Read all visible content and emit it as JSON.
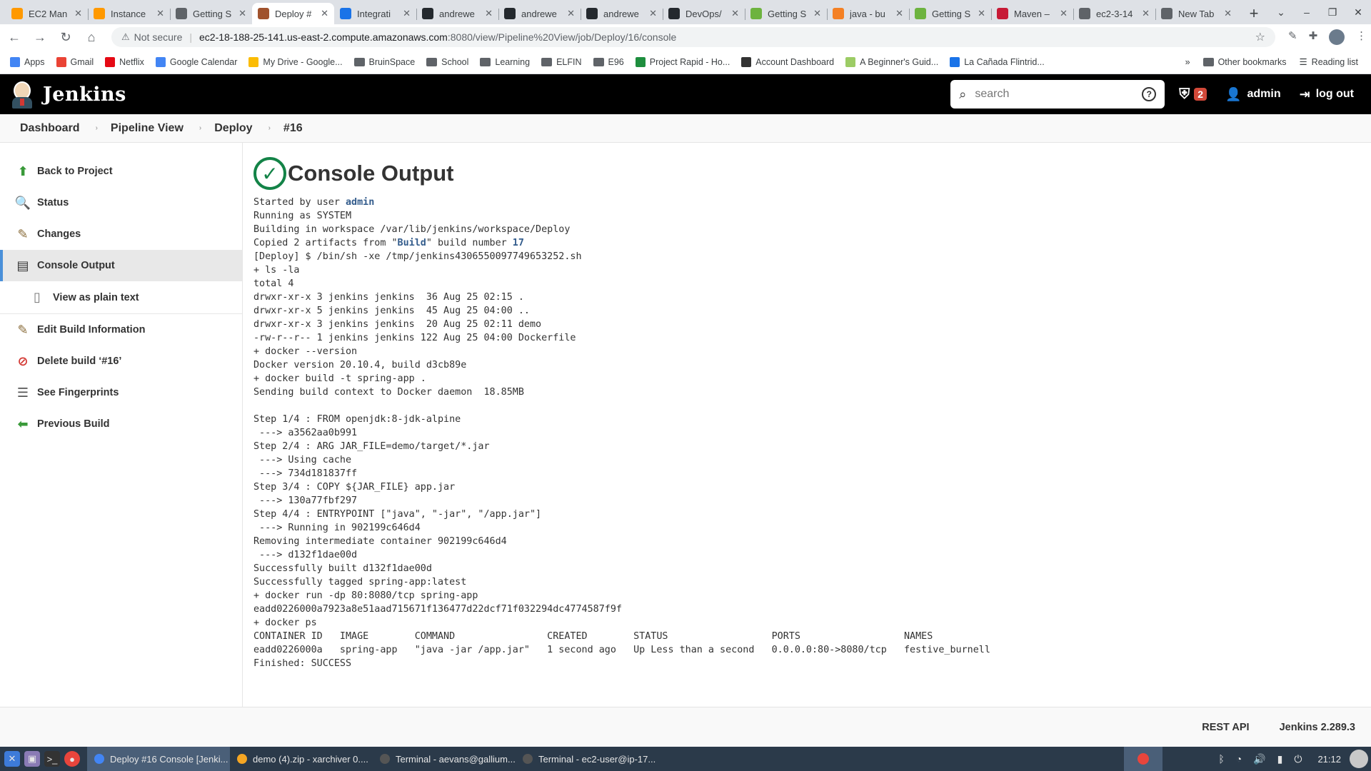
{
  "browser": {
    "tabs": [
      {
        "title": "EC2 Man",
        "color": "#ff9900"
      },
      {
        "title": "Instance",
        "color": "#ff9900"
      },
      {
        "title": "Getting S",
        "color": "#5f6368"
      },
      {
        "title": "Deploy #",
        "color": "#a0522d"
      },
      {
        "title": "Integrati",
        "color": "#1a73e8"
      },
      {
        "title": "andrewe",
        "color": "#24292e"
      },
      {
        "title": "andrewe",
        "color": "#24292e"
      },
      {
        "title": "andrewe",
        "color": "#24292e"
      },
      {
        "title": "DevOps/",
        "color": "#24292e"
      },
      {
        "title": "Getting S",
        "color": "#6db33f"
      },
      {
        "title": "java - bu",
        "color": "#f48024"
      },
      {
        "title": "Getting S",
        "color": "#6db33f"
      },
      {
        "title": "Maven –",
        "color": "#c71a36"
      },
      {
        "title": "ec2-3-14",
        "color": "#5f6368"
      },
      {
        "title": "New Tab",
        "color": "#5f6368"
      }
    ],
    "active_tab_index": 3,
    "new_tab_label": "+",
    "address": {
      "security_label": "Not secure",
      "host": "ec2-18-188-25-141.us-east-2.compute.amazonaws.com",
      "path": ":8080/view/Pipeline%20View/job/Deploy/16/console"
    },
    "bookmarks": [
      {
        "label": "Apps",
        "color": "#4285f4"
      },
      {
        "label": "Gmail",
        "color": "#ea4335"
      },
      {
        "label": "Netflix",
        "color": "#e50914"
      },
      {
        "label": "Google Calendar",
        "color": "#4285f4"
      },
      {
        "label": "My Drive - Google...",
        "color": "#fbbc04"
      },
      {
        "label": "BruinSpace",
        "color": "folder"
      },
      {
        "label": "School",
        "color": "folder"
      },
      {
        "label": "Learning",
        "color": "folder"
      },
      {
        "label": "ELFIN",
        "color": "folder"
      },
      {
        "label": "E96",
        "color": "folder"
      },
      {
        "label": "Project Rapid - Ho...",
        "color": "#1e8e3e"
      },
      {
        "label": "Account Dashboard",
        "color": "#333333"
      },
      {
        "label": "A Beginner's Guid...",
        "color": "#9ccc65"
      },
      {
        "label": "La Cañada Flintrid...",
        "color": "#1a73e8"
      }
    ],
    "bookmarks_more": "»",
    "other_bookmarks": "Other bookmarks",
    "reading_list": "Reading list"
  },
  "header": {
    "title": "Jenkins",
    "search_placeholder": "search",
    "help_label": "?",
    "alert_count": "2",
    "user": "admin",
    "logout": "log out"
  },
  "breadcrumbs": [
    "Dashboard",
    "Pipeline View",
    "Deploy",
    "#16"
  ],
  "sidebar": {
    "items": [
      {
        "label": "Back to Project",
        "icon": "up-arrow-icon"
      },
      {
        "label": "Status",
        "icon": "magnifier-icon"
      },
      {
        "label": "Changes",
        "icon": "notepad-icon"
      },
      {
        "label": "Console Output",
        "icon": "terminal-icon"
      },
      {
        "label": "View as plain text",
        "icon": "document-icon"
      },
      {
        "label": "Edit Build Information",
        "icon": "notepad-icon"
      },
      {
        "label": "Delete build ‘#16’",
        "icon": "no-entry-icon"
      },
      {
        "label": "See Fingerprints",
        "icon": "fingerprint-icon"
      },
      {
        "label": "Previous Build",
        "icon": "left-arrow-icon"
      }
    ]
  },
  "main": {
    "title": "Console Output",
    "status_icon": "success-check-icon",
    "console": {
      "started_prefix": "Started by user ",
      "started_user": "admin",
      "block1": "Running as SYSTEM\nBuilding in workspace /var/lib/jenkins/workspace/Deploy",
      "copied_prefix": "Copied 2 artifacts from \"",
      "copied_job": "Build",
      "copied_middle": "\" build number ",
      "copied_build": "17",
      "block2": "[Deploy] $ /bin/sh -xe /tmp/jenkins4306550097749653252.sh\n+ ls -la\ntotal 4\ndrwxr-xr-x 3 jenkins jenkins  36 Aug 25 02:15 .\ndrwxr-xr-x 5 jenkins jenkins  45 Aug 25 04:00 ..\ndrwxr-xr-x 3 jenkins jenkins  20 Aug 25 02:11 demo\n-rw-r--r-- 1 jenkins jenkins 122 Aug 25 04:00 Dockerfile\n+ docker --version\nDocker version 20.10.4, build d3cb89e\n+ docker build -t spring-app .\nSending build context to Docker daemon  18.85MB\n\nStep 1/4 : FROM openjdk:8-jdk-alpine\n ---> a3562aa0b991\nStep 2/4 : ARG JAR_FILE=demo/target/*.jar\n ---> Using cache\n ---> 734d181837ff\nStep 3/4 : COPY ${JAR_FILE} app.jar\n ---> 130a77fbf297\nStep 4/4 : ENTRYPOINT [\"java\", \"-jar\", \"/app.jar\"]\n ---> Running in 902199c646d4\nRemoving intermediate container 902199c646d4\n ---> d132f1dae00d\nSuccessfully built d132f1dae00d\nSuccessfully tagged spring-app:latest\n+ docker run -dp 80:8080/tcp spring-app\neadd0226000a7923a8e51aad715671f136477d22dcf71f032294dc4774587f9f\n+ docker ps\nCONTAINER ID   IMAGE        COMMAND                CREATED        STATUS                  PORTS                  NAMES\neadd0226000a   spring-app   \"java -jar /app.jar\"   1 second ago   Up Less than a second   0.0.0.0:80->8080/tcp   festive_burnell\nFinished: SUCCESS"
    }
  },
  "footer": {
    "rest_api": "REST API",
    "version": "Jenkins 2.289.3"
  },
  "taskbar": {
    "tasks": [
      {
        "label": "Deploy #16 Console [Jenki...",
        "color": "#4285f4"
      },
      {
        "label": "demo (4).zip - xarchiver 0....",
        "color": "#f5a623"
      },
      {
        "label": "Terminal - aevans@gallium...",
        "color": "#555555"
      },
      {
        "label": "Terminal - ec2-user@ip-17...",
        "color": "#555555"
      }
    ],
    "clock": "21:12"
  }
}
